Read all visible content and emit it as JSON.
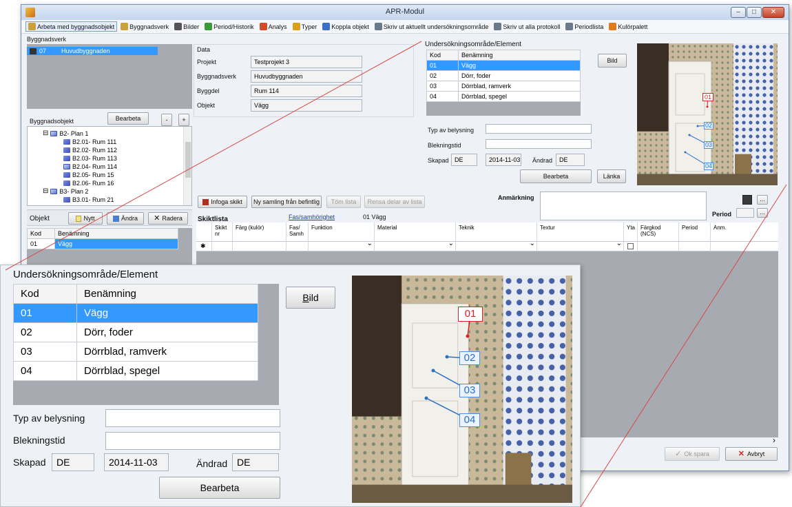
{
  "window": {
    "title": "APR-Modul"
  },
  "toolbar": [
    {
      "label": "Arbeta med byggnadsobjekt",
      "icon": "building-icon",
      "active": true,
      "color": "#c9a23a"
    },
    {
      "label": "Byggnadsverk",
      "icon": "building-icon",
      "color": "#c9a23a"
    },
    {
      "label": "Bilder",
      "icon": "camera-icon",
      "color": "#555555"
    },
    {
      "label": "Period/Historik",
      "icon": "history-icon",
      "color": "#3a9a3a"
    },
    {
      "label": "Analys",
      "icon": "chart-icon",
      "color": "#d24a2a"
    },
    {
      "label": "Typer",
      "icon": "list-icon",
      "color": "#d9a01a"
    },
    {
      "label": "Koppla objekt",
      "icon": "link-icon",
      "color": "#3a6fc8"
    },
    {
      "label": "Skriv ut aktuellt undersökningsområde",
      "icon": "printer-icon",
      "color": "#6a7a8a"
    },
    {
      "label": "Skriv ut alla protokoll",
      "icon": "printer-icon",
      "color": "#6a7a8a"
    },
    {
      "label": "Periodlista",
      "icon": "printer-icon",
      "color": "#6a7a8a"
    },
    {
      "label": "Kulörpalett",
      "icon": "palette-icon",
      "color": "#e07a1a"
    }
  ],
  "byggnadsverk": {
    "label": "Byggnadsverk",
    "row": {
      "code": "07",
      "name": "Huvudbyggnaden"
    }
  },
  "byggnadsobjekt": {
    "label": "Byggnadsobjekt",
    "edit_button": "Bearbeta",
    "minus": "-",
    "plus": "+",
    "tree": [
      {
        "label": "B2- Plan 1",
        "level": 1,
        "expander": "⊟",
        "type": "book"
      },
      {
        "label": "B2.01- Rum 111",
        "level": 2,
        "type": "item"
      },
      {
        "label": "B2.02- Rum 112",
        "level": 2,
        "type": "item"
      },
      {
        "label": "B2.03- Rum 113",
        "level": 2,
        "type": "item"
      },
      {
        "label": "B2.04- Rum 114",
        "level": 2,
        "type": "book"
      },
      {
        "label": "B2.05- Rum 15",
        "level": 2,
        "type": "item"
      },
      {
        "label": "B2.06- Rum 16",
        "level": 2,
        "type": "item"
      },
      {
        "label": "B3- Plan 2",
        "level": 1,
        "expander": "⊟",
        "type": "book"
      },
      {
        "label": "B3.01- Rum 21",
        "level": 2,
        "type": "item"
      }
    ]
  },
  "objekt": {
    "label": "Objekt",
    "buttons": {
      "new": "Nytt",
      "edit": "Ändra",
      "delete": "Radera"
    },
    "headers": {
      "code": "Kod",
      "name": "Benämning"
    },
    "row": {
      "code": "01",
      "name": "Vägg"
    }
  },
  "data_section": {
    "label": "Data",
    "fields": [
      {
        "label": "Projekt",
        "value": "Testprojekt 3"
      },
      {
        "label": "Byggnadsverk",
        "value": "Huvudbyggnaden"
      },
      {
        "label": "Byggdel",
        "value": "Rum 114"
      },
      {
        "label": "Objekt",
        "value": "Vägg"
      }
    ]
  },
  "undersokning": {
    "label": "Undersökningsområde/Element",
    "headers": {
      "code": "Kod",
      "name": "Benämning"
    },
    "rows": [
      {
        "code": "01",
        "name": "Vägg",
        "selected": true
      },
      {
        "code": "02",
        "name": "Dörr, foder"
      },
      {
        "code": "03",
        "name": "Dörrblad, ramverk"
      },
      {
        "code": "04",
        "name": "Dörrblad, spegel"
      }
    ],
    "bild_button": "Bild",
    "bild_hotkey": "B",
    "bild_rest": "ild",
    "typ_label": "Typ av belysning",
    "typ_value": "",
    "blek_label": "Blekningstid",
    "blek_value": "",
    "skapad_label": "Skapad",
    "skapad_by": "DE",
    "skapad_date": "2014-11-03",
    "andrad_label": "Ändrad",
    "andrad_by": "DE",
    "bearbeta_button": "Bearbeta",
    "lanka_button": "Länka"
  },
  "photo_tags": [
    {
      "label": "01",
      "style": "red"
    },
    {
      "label": "02",
      "style": "blue"
    },
    {
      "label": "03",
      "style": "blue"
    },
    {
      "label": "04",
      "style": "blue"
    }
  ],
  "skikt_toolbar": {
    "infoga": "Infoga skikt",
    "ny_samling": "Ny samling från befintlig",
    "tom_lista": "Töm lista",
    "rensa": "Rensa delar av lista",
    "anmarkning_label": "Anmärkning",
    "anmarkning_value": "",
    "period_label": "Period",
    "ellipsis": "..."
  },
  "skiktlista": {
    "label": "Skiktlista",
    "fas_link": "Fas/samhörighet",
    "fas_value": "01 Vägg",
    "columns": [
      "Skikt nr",
      "Färg (kulör)",
      "Fas/ Samh",
      "Funktion",
      "Material",
      "Teknik",
      "Textur",
      "Yta",
      "Färgkod (NCS)",
      "Period",
      "Anm."
    ],
    "new_row_marker": "✱"
  },
  "footer": {
    "ok": "Ok spara",
    "cancel": "Avbryt",
    "scroll_right": "›"
  },
  "colors": {
    "selection": "#3399ff",
    "accent_red": "#dd2222",
    "accent_blue": "#2a6fc8"
  }
}
